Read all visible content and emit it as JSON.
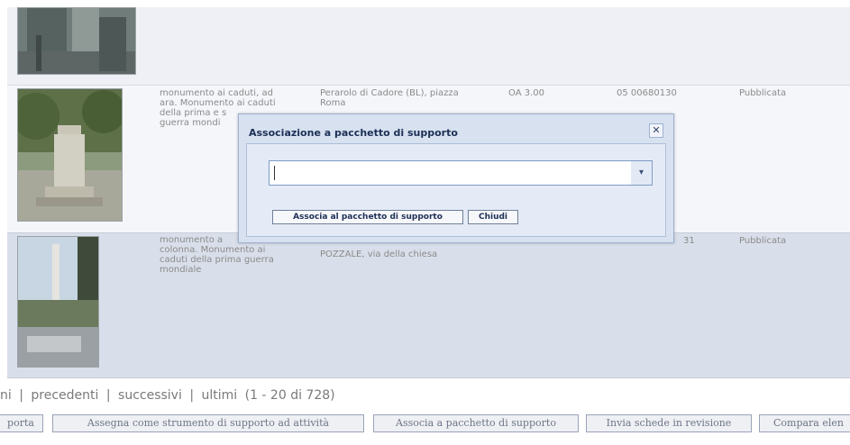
{
  "results": {
    "rows": [
      {
        "description": "",
        "location": "",
        "type_code": "",
        "code": "",
        "status": ""
      },
      {
        "description": "monumento ai caduti, ad\nara. Monumento ai caduti\ndella prima e s\nguerra mondi",
        "location": "Perarolo di Cadore (BL), piazza\nRoma",
        "type_code": "OA 3.00",
        "code": "05 00680130",
        "status": "Pubblicata"
      },
      {
        "description": "monumento a\ncolonna. Monumento ai\ncaduti della prima guerra\nmondiale",
        "location": "POZZALE, via della chiesa",
        "type_code": "",
        "code": "31",
        "status": "Pubblicata"
      }
    ]
  },
  "pager": {
    "first": "ni",
    "sep1": "|",
    "prev": "precedenti",
    "sep2": "|",
    "next": "successivi",
    "sep3": "|",
    "last": "ultimi",
    "range": "(1 - 20 di 728)"
  },
  "actions": {
    "export": "porta",
    "assign_tool": "Assegna come strumento di supporto ad attività",
    "assoc_package": "Associa a pacchetto di supporto",
    "send_review": "Invia schede in revisione",
    "compare": "Compara elen"
  },
  "dialog": {
    "title": "Associazione a pacchetto di supporto",
    "close_glyph": "✕",
    "select_value": "",
    "dropdown_glyph": "▾",
    "associate_label": "Associa al pacchetto di supporto",
    "close_label": "Chiudi"
  }
}
